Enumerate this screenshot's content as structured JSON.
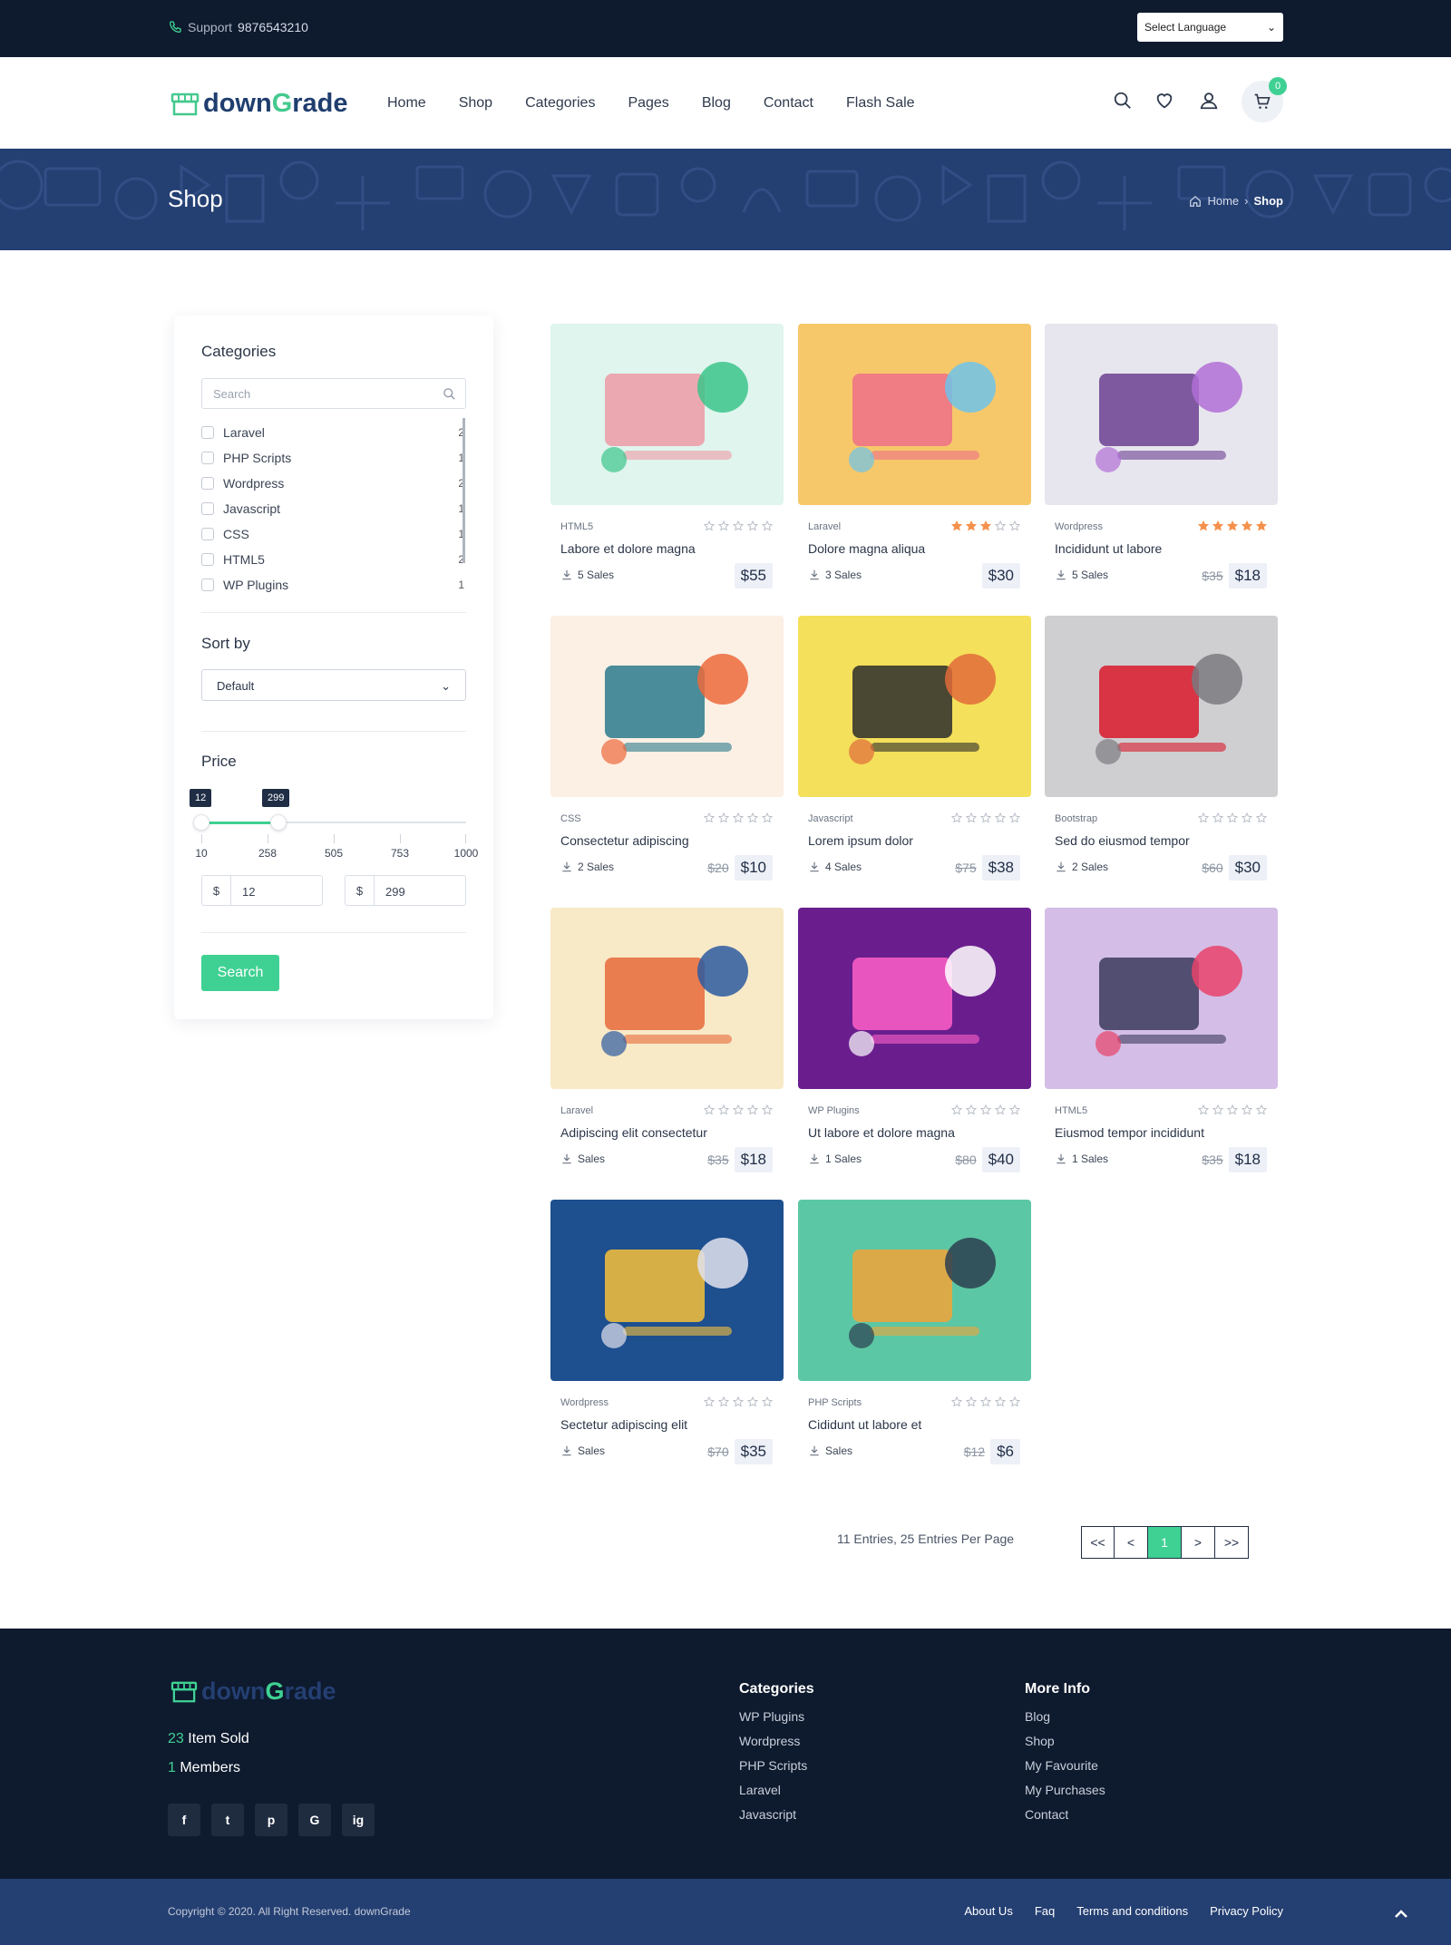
{
  "topbar": {
    "support_label": "Support",
    "support_phone": "9876543210",
    "language": "Select Language"
  },
  "brand": {
    "part1": "down",
    "part2": "G",
    "part3": "rade"
  },
  "nav": {
    "items": [
      "Home",
      "Shop",
      "Categories",
      "Pages",
      "Blog",
      "Contact",
      "Flash Sale"
    ],
    "cart_count": "0"
  },
  "hero": {
    "title": "Shop",
    "crumb_home": "Home",
    "crumb_current": "Shop"
  },
  "sidebar": {
    "categories_title": "Categories",
    "search_placeholder": "Search",
    "categories": [
      {
        "label": "Laravel",
        "count": "2"
      },
      {
        "label": "PHP Scripts",
        "count": "1"
      },
      {
        "label": "Wordpress",
        "count": "2"
      },
      {
        "label": "Javascript",
        "count": "1"
      },
      {
        "label": "CSS",
        "count": "1"
      },
      {
        "label": "HTML5",
        "count": "2"
      },
      {
        "label": "WP Plugins",
        "count": "1"
      }
    ],
    "sort_title": "Sort by",
    "sort_value": "Default",
    "price_title": "Price",
    "price_min": "12",
    "price_max": "299",
    "scale": [
      "10",
      "258",
      "505",
      "753",
      "1000"
    ],
    "currency": "$",
    "search_button": "Search"
  },
  "products": [
    {
      "category": "HTML5",
      "title": "Labore et dolore magna",
      "sales": "5 Sales",
      "old_price": "",
      "price": "$55",
      "rating": 0
    },
    {
      "category": "Laravel",
      "title": "Dolore magna aliqua",
      "sales": "3 Sales",
      "old_price": "",
      "price": "$30",
      "rating": 3
    },
    {
      "category": "Wordpress",
      "title": "Incididunt ut labore",
      "sales": "5 Sales",
      "old_price": "$35",
      "price": "$18",
      "rating": 5
    },
    {
      "category": "CSS",
      "title": "Consectetur adipiscing",
      "sales": "2 Sales",
      "old_price": "$20",
      "price": "$10",
      "rating": 0
    },
    {
      "category": "Javascript",
      "title": "Lorem ipsum dolor",
      "sales": "4 Sales",
      "old_price": "$75",
      "price": "$38",
      "rating": 0
    },
    {
      "category": "Bootstrap",
      "title": "Sed do eiusmod tempor",
      "sales": "2 Sales",
      "old_price": "$60",
      "price": "$30",
      "rating": 0
    },
    {
      "category": "Laravel",
      "title": "Adipiscing elit consectetur",
      "sales": "Sales",
      "old_price": "$35",
      "price": "$18",
      "rating": 0
    },
    {
      "category": "WP Plugins",
      "title": "Ut labore et dolore magna",
      "sales": "1 Sales",
      "old_price": "$80",
      "price": "$40",
      "rating": 0
    },
    {
      "category": "HTML5",
      "title": "Eiusmod tempor incididunt",
      "sales": "1 Sales",
      "old_price": "$35",
      "price": "$18",
      "rating": 0
    },
    {
      "category": "Wordpress",
      "title": "Sectetur adipiscing elit",
      "sales": "Sales",
      "old_price": "$70",
      "price": "$35",
      "rating": 0
    },
    {
      "category": "PHP Scripts",
      "title": "Cididunt ut labore et",
      "sales": "Sales",
      "old_price": "$12",
      "price": "$6",
      "rating": 0
    }
  ],
  "pagination": {
    "info": "11 Entries, 25 Entries Per Page",
    "first": "<<",
    "prev": "<",
    "current": "1",
    "next": ">",
    "last": ">>"
  },
  "footer": {
    "stat1_num": "23",
    "stat1_label": " Item Sold",
    "stat2_num": "1",
    "stat2_label": " Members",
    "social": [
      "f",
      "t",
      "p",
      "G",
      "ig"
    ],
    "cat_title": "Categories",
    "cat_links": [
      "WP Plugins",
      "Wordpress",
      "PHP Scripts",
      "Laravel",
      "Javascript"
    ],
    "more_title": "More Info",
    "more_links": [
      "Blog",
      "Shop",
      "My Favourite",
      "My Purchases",
      "Contact"
    ],
    "copyright": "Copyright © 2020. All Right Reserved. downGrade",
    "bottom_links": [
      "About Us",
      "Faq",
      "Terms and conditions",
      "Privacy Policy"
    ]
  },
  "colors": {
    "accent": "#3fd193",
    "brand": "#243f72",
    "dark": "#0e1a2e",
    "star": "#f5914c"
  }
}
